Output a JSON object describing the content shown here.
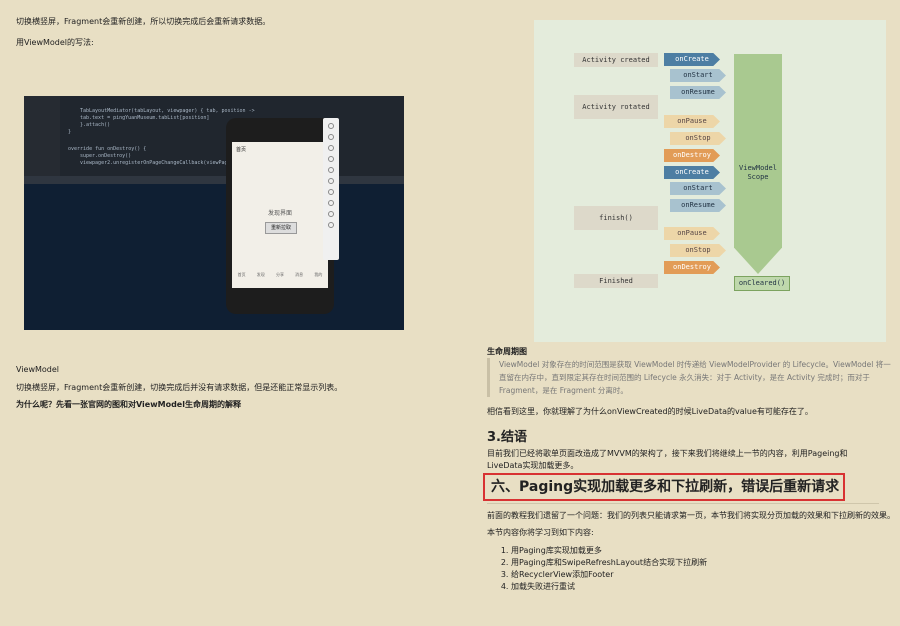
{
  "left": {
    "p1": "切换横竖屏，Fragment会重新创建，所以切换完成后会重新请求数据。",
    "p2": "用ViewModel的写法:",
    "code_lines": [
      "TabLayoutMediator(tabLayout, viewpager) { tab, position ->",
      "    tab.text = pingYuanMuseum.tabList[position]",
      "}.attach()",
      "}",
      "override fun onDestroy() {",
      "    super.onDestroy()",
      "    viewpager2.unregisterOnPageChangeCallback(viewPagerCall"
    ],
    "phone_header": "首页",
    "phone_text": "发现界面",
    "phone_button": "重新拉取",
    "phone_tabs": [
      "首页",
      "发现",
      "分享",
      "消息",
      "我的"
    ],
    "h_viewmodel": "ViewModel",
    "p3": "切换横竖屏，Fragment会重新创建，切换完成后并没有请求数据，但是还能正常显示列表。",
    "p4": "为什么呢？先看一张官网的图和对ViewModel生命周期的解释"
  },
  "diagram": {
    "states": [
      "Activity created",
      "Activity rotated",
      "finish()",
      "Finished"
    ],
    "events": [
      "onCreate",
      "onStart",
      "onResume",
      "onPause",
      "onStop",
      "onDestroy",
      "onCreate",
      "onStart",
      "onResume",
      "onPause",
      "onStop",
      "onDestroy"
    ],
    "scope": "ViewModel\nScope",
    "cleared": "onCleared()"
  },
  "right": {
    "caption": "生命周期图",
    "quote": "ViewModel 对象存在的时间范围是获取 ViewModel 时传递给 ViewModelProvider 的 Lifecycle。ViewModel 将一直留在内存中，直到限定其存在时间范围的 Lifecycle 永久消失：对于 Activity，是在 Activity 完成时；而对于 Fragment，是在 Fragment 分离时。",
    "p_understand": "相信看到这里，你就理解了为什么onViewCreated的时候LiveData的value有可能存在了。",
    "h_conclusion": "3.结语",
    "p_conclusion": "目前我们已经将歌单页面改造成了MVVM的架构了，接下来我们将继续上一节的内容，利用Pageing和LiveData实现加载更多。",
    "h_paging": "六、Paging实现加载更多和下拉刷新，错误后重新请求",
    "p_prev": "前面的教程我们遗留了一个问题：我们的列表只能请求第一页，本节我们将实现分页加载的效果和下拉刷新的效果。",
    "p_learn": "本节内容你将学习到如下内容:",
    "list": [
      "用Paging库实现加载更多",
      "用Paging库和SwipeRefreshLayout结合实现下拉刷新",
      "给RecyclerView添加Footer",
      "加载失败进行重试"
    ]
  },
  "colors": {
    "page_bg": "#e8dfc4",
    "highlight_border": "#d83232"
  }
}
